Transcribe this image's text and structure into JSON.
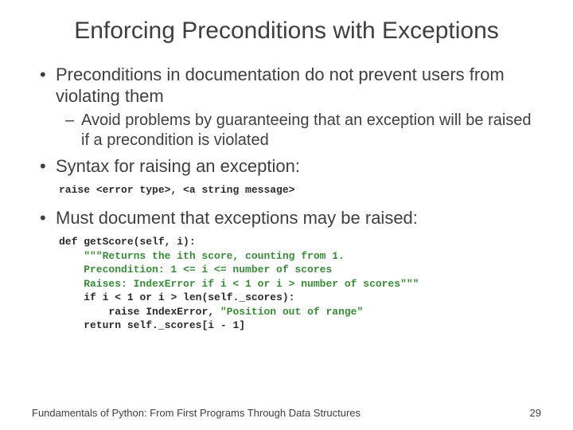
{
  "title": "Enforcing Preconditions with Exceptions",
  "bullets": {
    "b1": "Preconditions in documentation do not prevent users from violating them",
    "b1_sub": "Avoid problems by guaranteeing that an exception will be raised if a precondition is violated",
    "b2": "Syntax for raising an exception:",
    "b3": "Must document that exceptions may be raised:"
  },
  "code": {
    "syntax_raise": "raise",
    "syntax_rest": " <error type>, <a string message>",
    "def_line_kw": "def",
    "def_line_rest": " getScore(self, i):",
    "doc1": "    \"\"\"Returns the ith score, counting from 1.",
    "doc2": "    Precondition: 1 <= i <= number of scores",
    "doc3": "    Raises: IndexError if i < 1 or i > number of scores\"\"\"",
    "if_kw": "if",
    "if_rest": " i < 1 ",
    "or_kw": "or",
    "or_rest": " i > len(self._scores):",
    "raise_kw": "raise",
    "raise_rest1": " IndexError, ",
    "raise_str": "\"Position out of range\"",
    "return_kw": "return",
    "return_rest": " self._scores[i - 1]"
  },
  "footer": {
    "text": "Fundamentals of Python: From First Programs Through Data Structures",
    "page": "29"
  }
}
